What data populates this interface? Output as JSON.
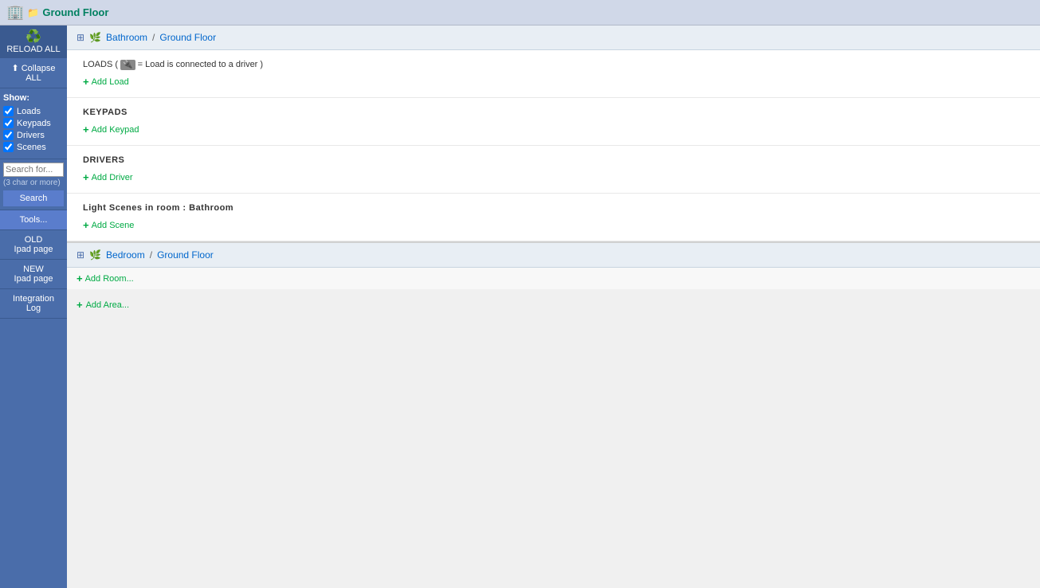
{
  "topbar": {
    "title": "Ground Floor",
    "floor_icon": "🏢",
    "folder_icon": "📂"
  },
  "sidebar": {
    "reload_label": "RELOAD ALL",
    "collapse_label": "Collapse ALL",
    "show_label": "Show:",
    "checkboxes": [
      {
        "label": "Loads",
        "checked": true
      },
      {
        "label": "Keypads",
        "checked": true
      },
      {
        "label": "Drivers",
        "checked": true
      },
      {
        "label": "Scenes",
        "checked": true
      }
    ],
    "search_placeholder": "Search for...",
    "search_hint": "(3 char or more)",
    "search_btn": "Search",
    "tools_btn": "Tools...",
    "old_ipad_line1": "OLD",
    "old_ipad_line2": "Ipad page",
    "new_ipad_line1": "NEW",
    "new_ipad_line2": "Ipad page",
    "integration_line1": "Integration",
    "integration_line2": "Log"
  },
  "rooms": [
    {
      "name": "Bathroom",
      "area": "Ground Floor",
      "sections": [
        {
          "type": "loads",
          "title": "LOADS",
          "description": "= Load is connected to a driver",
          "add_label": "Add Load"
        },
        {
          "type": "keypads",
          "title": "KEYPADS",
          "add_label": "Add Keypad"
        },
        {
          "type": "drivers",
          "title": "DRIVERS",
          "add_label": "Add Driver"
        },
        {
          "type": "scenes",
          "title": "Light Scenes in room : Bathroom",
          "add_label": "Add Scene"
        }
      ]
    },
    {
      "name": "Bedroom",
      "area": "Ground Floor",
      "add_room_label": "Add Room..."
    }
  ],
  "add_area_label": "Add Area..."
}
